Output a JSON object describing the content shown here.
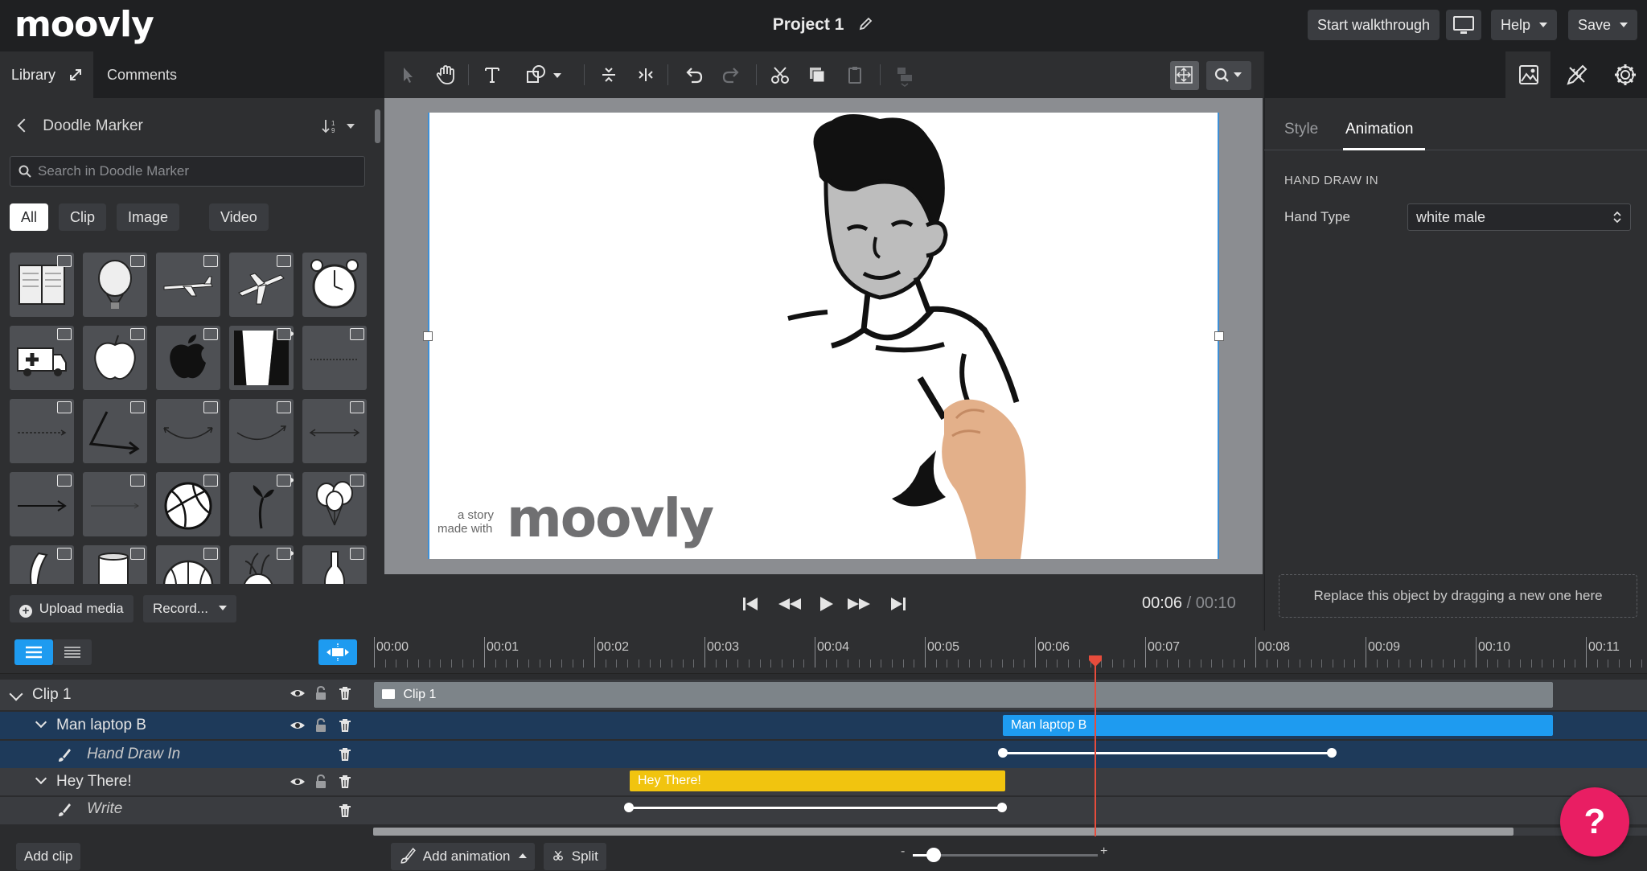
{
  "app": {
    "logo": "moovly",
    "project_title": "Project 1",
    "start_walkthrough": "Start walkthrough",
    "help": "Help",
    "save": "Save"
  },
  "library": {
    "tab_library": "Library",
    "tab_comments": "Comments",
    "category": "Doodle Marker",
    "search_placeholder": "Search in Doodle Marker",
    "filters": [
      "All",
      "Clip",
      "Image",
      "Video"
    ],
    "upload_media": "Upload media",
    "record": "Record..."
  },
  "stage": {
    "watermark_small_1": "a story",
    "watermark_small_2": "made with",
    "watermark_big": "moovly"
  },
  "playback": {
    "current_time": "00:06",
    "separator": "/",
    "total_time": "00:10"
  },
  "properties": {
    "tab_style": "Style",
    "tab_animation": "Animation",
    "section_title": "HAND DRAW IN",
    "hand_type_label": "Hand Type",
    "hand_type_value": "white male",
    "replace_hint": "Replace this object by dragging a new one here"
  },
  "timeline": {
    "ticks": [
      "00:00",
      "00:01",
      "00:02",
      "00:03",
      "00:04",
      "00:05",
      "00:06",
      "00:07",
      "00:08",
      "00:09",
      "00:10",
      "00:11"
    ],
    "playhead_time": 6.55,
    "rows": {
      "clip_name": "Clip 1",
      "clip_bar": "Clip 1",
      "obj1_name": "Man laptop B",
      "obj1_bar": "Man laptop B",
      "obj1_anim": "Hand Draw In",
      "obj2_name": "Hey There!",
      "obj2_bar": "Hey There!",
      "obj2_anim": "Write"
    },
    "colors": {
      "clip_bar": "#7d8489",
      "selected_bar": "#1e9bf0",
      "text_bar": "#f1c40f",
      "selected_row": "#1e3a5a",
      "playhead": "#e74c3c"
    }
  },
  "bottom": {
    "add_clip": "Add clip",
    "add_animation": "Add animation",
    "split": "Split",
    "zoom_minus": "-",
    "zoom_plus": "+",
    "help_fab": "?"
  }
}
